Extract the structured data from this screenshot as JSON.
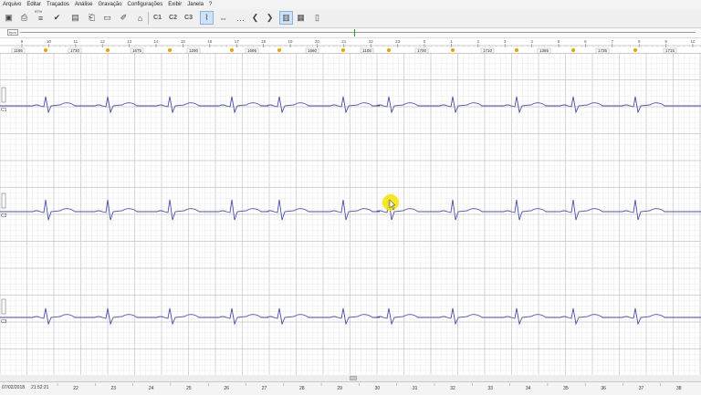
{
  "menu": [
    "Arquivo",
    "Editar",
    "Traçados",
    "Análise",
    "Gravação",
    "Configurações",
    "Exibir",
    "Janela",
    "?"
  ],
  "toolbar": {
    "icons": [
      "cube-icon",
      "printer-icon",
      "bars-icon",
      "checkmark-icon",
      "scanner-icon",
      "print-preview-icon",
      "tape-icon",
      "marker-icon",
      "pin-icon",
      "channel-c1",
      "channel-c2",
      "channel-c3",
      "ecg-cursor-icon",
      "interval-measure-icon",
      "dots-icon",
      "arrow-left-icon",
      "arrow-right-icon",
      "layout-single-icon",
      "layout-film-icon",
      "layout-page-icon"
    ],
    "labels": {
      "c1": "C1",
      "c2": "C2",
      "c3": "C3",
      "lr1": "97%"
    }
  },
  "overview": {
    "label": "bpm"
  },
  "ruler": {
    "ticks": [
      "9",
      "10",
      "11",
      "12",
      "13",
      "14",
      "15",
      "16",
      "17",
      "18",
      "19",
      "20",
      "21",
      "22",
      "23",
      "0",
      "1",
      "2",
      "3",
      "4",
      "5",
      "6",
      "7",
      "8",
      "9",
      "10"
    ],
    "rr_values": [
      "1195",
      "1730",
      "1675",
      "1290",
      "1695",
      "1660",
      "1105",
      "1700",
      "1710",
      "1365",
      "1735",
      "1715"
    ]
  },
  "channels": [
    {
      "label": "C1"
    },
    {
      "label": "C2"
    },
    {
      "label": "C3"
    }
  ],
  "status": {
    "date": "07/02/2018",
    "time": "21:52:21",
    "time_ticks": [
      "22",
      "23",
      "24",
      "25",
      "26",
      "27",
      "28",
      "29",
      "30",
      "31",
      "32",
      "33",
      "34",
      "35",
      "36",
      "37",
      "38"
    ]
  },
  "colors": {
    "trace": "#4b4fa6",
    "grid_minor": "#e3e3e3",
    "grid_major": "#c4c4c4",
    "cursor": "#f5e400",
    "marker": "#e6a300"
  }
}
